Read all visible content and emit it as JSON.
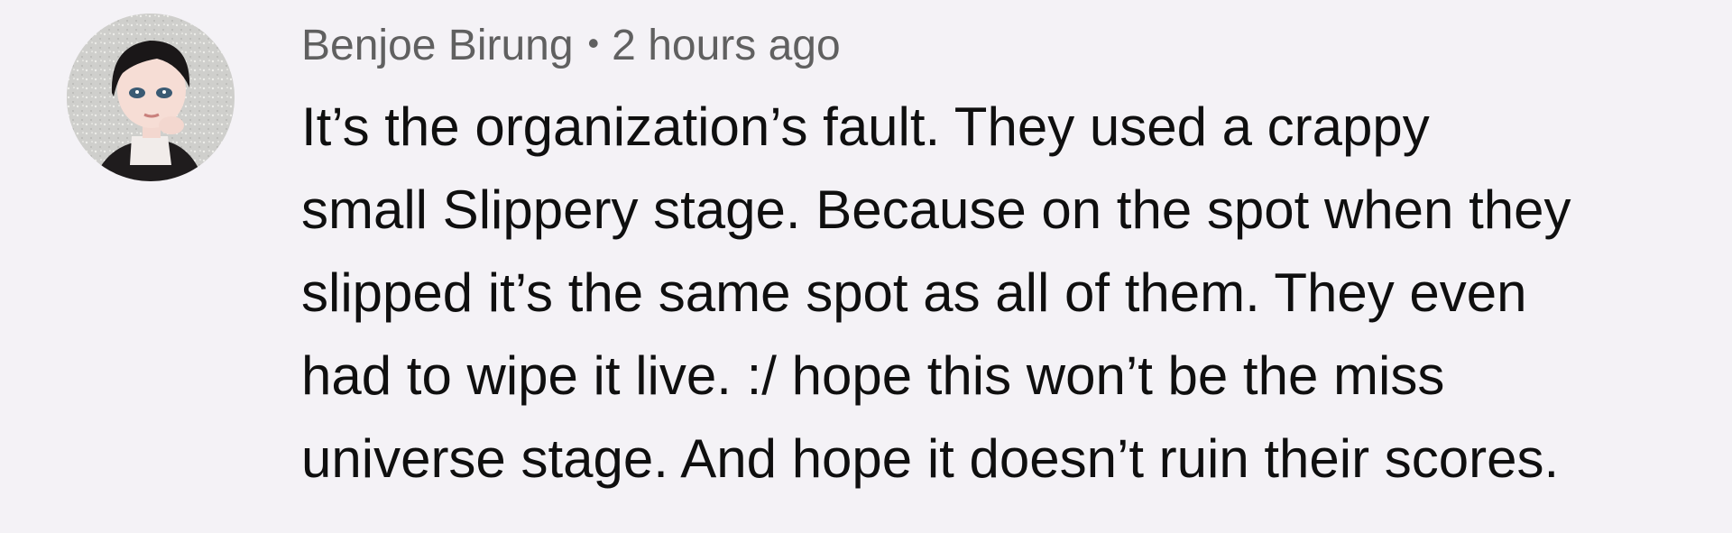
{
  "comment": {
    "author": "Benjoe Birung",
    "separator": "•",
    "timestamp": "2 hours ago",
    "avatar_icon": "user-avatar-icon",
    "text": "It’s the organization’s fault. They used a crappy\nsmall Slippery stage. Because on the spot when they\nslipped it’s the same spot as all of them. They even\nhad to wipe it live. :/ hope this won’t be the miss\nuniverse stage. And hope it doesn’t ruin their scores."
  },
  "colors": {
    "background": "#f4f2f6",
    "meta_text": "#606060",
    "body_text": "#0f0f0f"
  }
}
